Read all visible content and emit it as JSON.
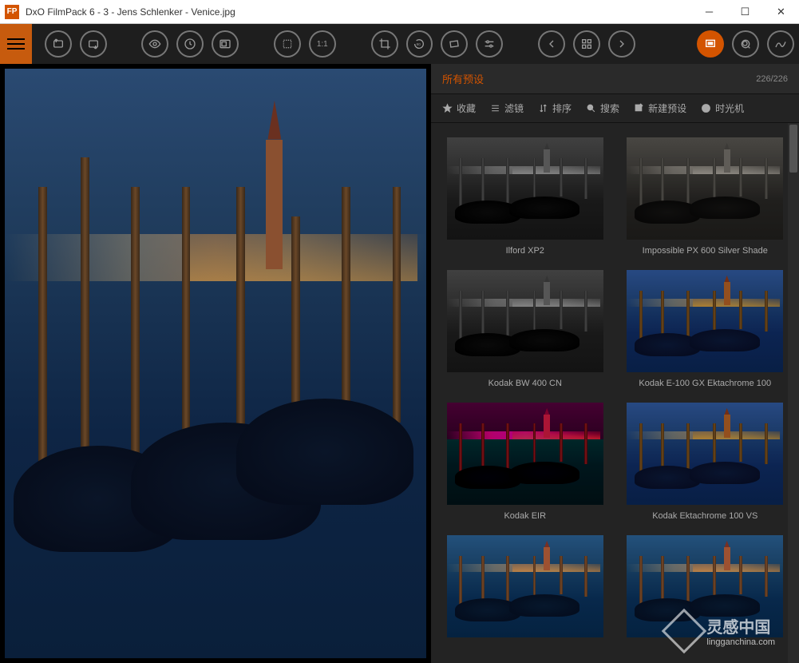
{
  "titlebar": {
    "app_icon_text": "FP",
    "title": "DxO FilmPack 6 - 3 - Jens Schlenker - Venice.jpg"
  },
  "toolbar": {
    "ratio_label": "1:1"
  },
  "panel": {
    "header_title": "所有预设",
    "count": "226/226"
  },
  "filters": {
    "favorites": "收藏",
    "filter": "滤镜",
    "sort": "排序",
    "search": "搜索",
    "new_preset": "新建预设",
    "time_machine": "时光机"
  },
  "presets": [
    {
      "label": "Ilford XP2",
      "variant": "bw"
    },
    {
      "label": "Impossible PX 600 Silver Shade",
      "variant": "sepia-bw"
    },
    {
      "label": "Kodak BW 400 CN",
      "variant": "bw"
    },
    {
      "label": "Kodak E-100 GX Ektachrome 100",
      "variant": "warm"
    },
    {
      "label": "Kodak EIR",
      "variant": "ir"
    },
    {
      "label": "Kodak Ektachrome 100 VS",
      "variant": "warm"
    },
    {
      "label": "",
      "variant": "cool"
    },
    {
      "label": "",
      "variant": "cool"
    }
  ],
  "watermark": {
    "text": "灵感中国",
    "sub": "lingganchina.com"
  }
}
